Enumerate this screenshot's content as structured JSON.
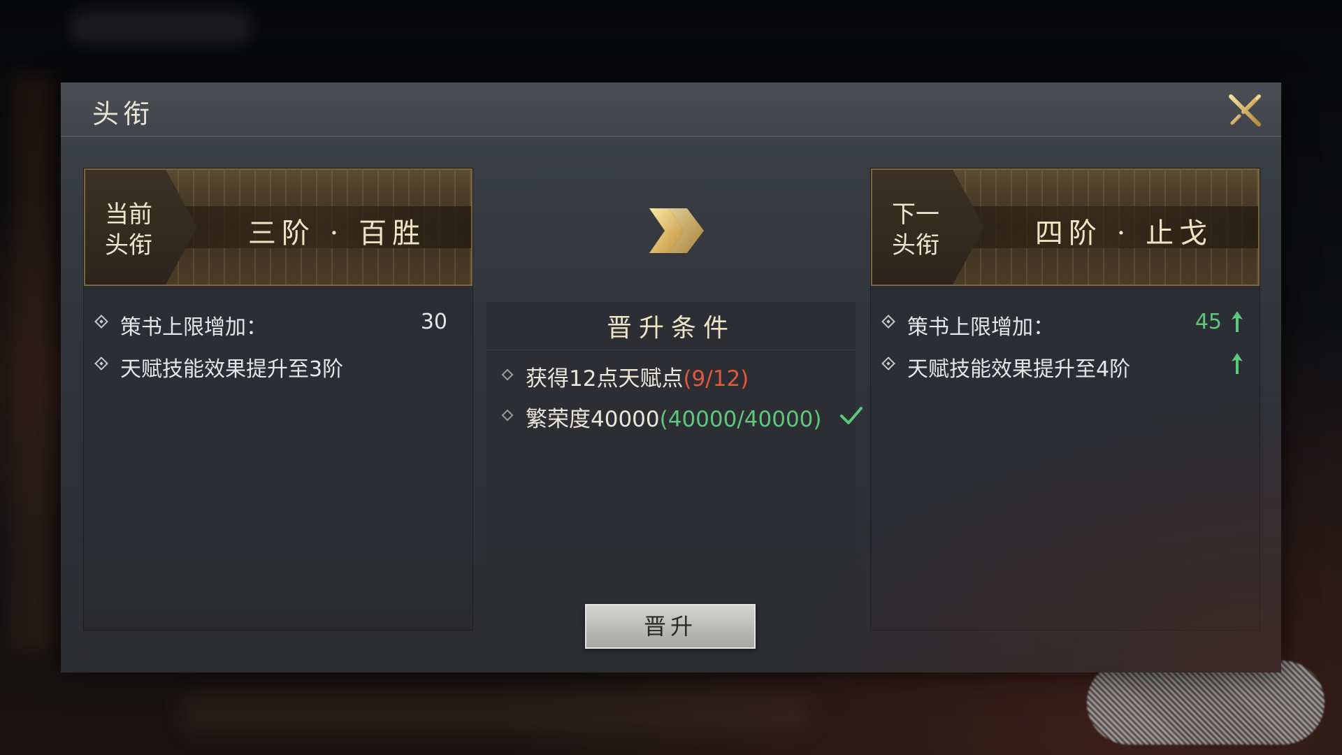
{
  "dialog": {
    "title": "头衔",
    "close_icon": "close-icon"
  },
  "current": {
    "tag": "当前头衔",
    "rank_name": "三阶 · 百胜",
    "stats": [
      {
        "label": "策书上限增加：",
        "value": "30"
      },
      {
        "label": "天赋技能效果提升至3阶",
        "value": ""
      }
    ]
  },
  "next": {
    "tag": "下一头衔",
    "rank_name": "四阶 · 止戈",
    "stats": [
      {
        "label": "策书上限增加：",
        "value": "45",
        "trend": "up"
      },
      {
        "label": "天赋技能效果提升至4阶",
        "value": "",
        "trend": "up"
      }
    ]
  },
  "conditions": {
    "title": "晋升条件",
    "items": [
      {
        "label": "获得12点天赋点",
        "progress": "(9/12)",
        "status": "incomplete"
      },
      {
        "label": "繁荣度40000",
        "progress": "(40000/40000)",
        "status": "complete"
      }
    ]
  },
  "actions": {
    "promote_label": "晋升"
  },
  "colors": {
    "accent_gold": "#d7b25a",
    "positive_green": "#5fc77c",
    "warning_red": "#e3573b"
  }
}
